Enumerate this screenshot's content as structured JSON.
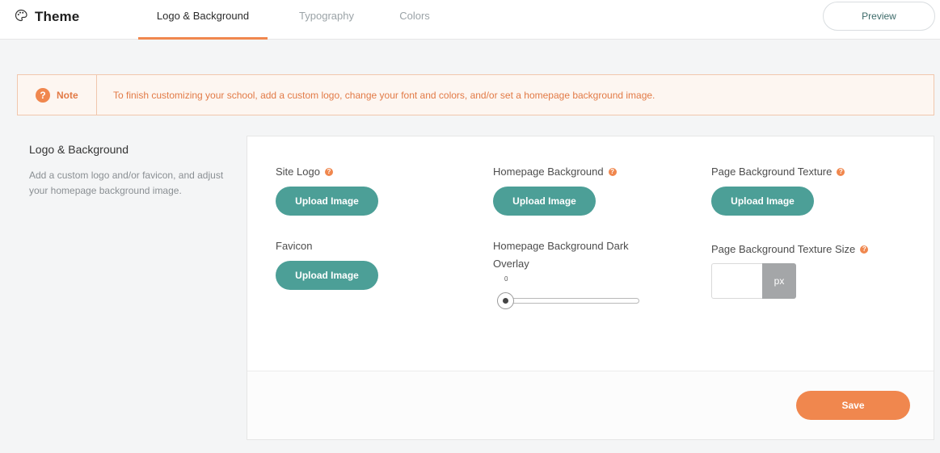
{
  "header": {
    "title": "Theme",
    "icon": "palette-icon",
    "tabs": [
      {
        "label": "Logo & Background",
        "active": true
      },
      {
        "label": "Typography",
        "active": false
      },
      {
        "label": "Colors",
        "active": false
      }
    ],
    "preview_label": "Preview"
  },
  "note": {
    "title": "Note",
    "icon": "question-circle-icon",
    "text": "To finish customizing your school, add a custom logo, change your font and colors, and/or set a homepage background image."
  },
  "section": {
    "title": "Logo & Background",
    "description": "Add a custom logo and/or favicon, and adjust your homepage background image."
  },
  "fields": {
    "site_logo": {
      "label": "Site Logo",
      "button": "Upload Image"
    },
    "homepage_background": {
      "label": "Homepage Background",
      "button": "Upload Image"
    },
    "page_background_texture": {
      "label": "Page Background Texture",
      "button": "Upload Image"
    },
    "favicon": {
      "label": "Favicon",
      "button": "Upload Image"
    },
    "dark_overlay": {
      "label_line1": "Homepage Background Dark",
      "label_line2": "Overlay",
      "value": "0"
    },
    "texture_size": {
      "label": "Page Background Texture Size",
      "value": "",
      "unit": "px"
    }
  },
  "footer": {
    "save_label": "Save"
  },
  "colors": {
    "accent": "#f0874e",
    "primary_button": "#4c9f97",
    "note_bg": "#fdf6f1"
  }
}
